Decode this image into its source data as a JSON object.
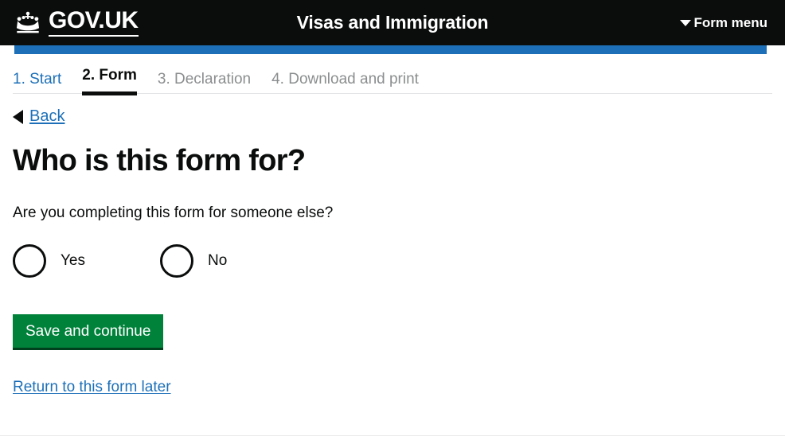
{
  "header": {
    "brand_name": "GOV.UK",
    "crown_icon": "crown-icon",
    "service_title": "Visas and Immigration",
    "form_menu_label": "Form menu",
    "form_menu_icon": "chevron-down-icon",
    "background_color": "#0b0c0c",
    "accent_bar_color": "#1d70b8"
  },
  "step_nav": {
    "steps": [
      {
        "label": "1. Start",
        "state": "link"
      },
      {
        "label": "2. Form",
        "state": "active"
      },
      {
        "label": "3. Declaration",
        "state": "muted"
      },
      {
        "label": "4. Download and print",
        "state": "muted"
      }
    ]
  },
  "back": {
    "label": "Back",
    "icon": "back-arrow-icon"
  },
  "main": {
    "heading": "Who is this form for?",
    "question": "Are you completing this form for someone else?",
    "radios": [
      {
        "label": "Yes",
        "value": "yes",
        "selected": false
      },
      {
        "label": "No",
        "value": "no",
        "selected": false
      }
    ],
    "save_button_label": "Save and continue",
    "return_link_label": "Return to this form later"
  },
  "colors": {
    "link": "#1d70b8",
    "text": "#0b0c0c",
    "muted_text": "#8b8e8f",
    "button_green": "#00823b",
    "button_green_shadow": "#00401d"
  }
}
